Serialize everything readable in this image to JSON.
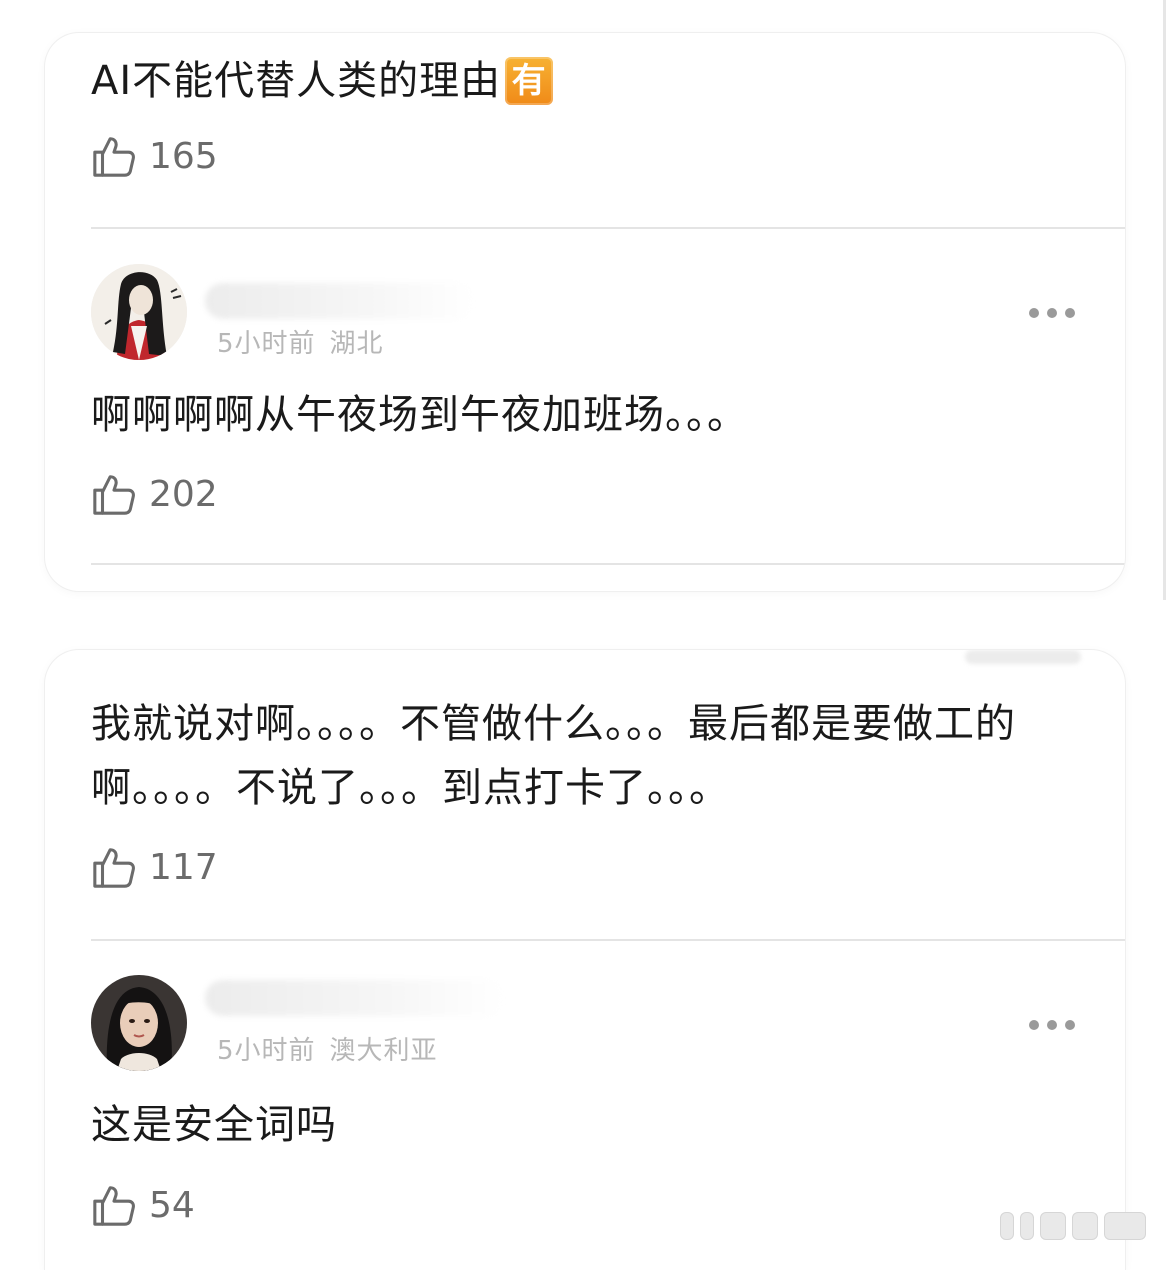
{
  "post": {
    "title": "AI不能代替人类的理由",
    "title_badge": "有",
    "likes": "165"
  },
  "comments": [
    {
      "time": "5小时前",
      "location": "湖北",
      "text": "啊啊啊啊从午夜场到午夜加班场。。。",
      "likes": "202"
    },
    {
      "text": "我就说对啊。。。。不管做什么。。。最后都是要做工的啊。。。。不说了。。。到点打卡了。。。",
      "likes": "117"
    },
    {
      "time": "5小时前",
      "location": "澳大利亚",
      "text": "这是安全词吗",
      "likes": "54"
    }
  ],
  "icons": {
    "like": "thumbs-up-icon",
    "more": "ellipsis-icon"
  },
  "colors": {
    "badge": "#f39a1e",
    "meta_text": "#b7b7b7",
    "like_text": "#6b6b6b",
    "divider": "#e4e4e4"
  }
}
